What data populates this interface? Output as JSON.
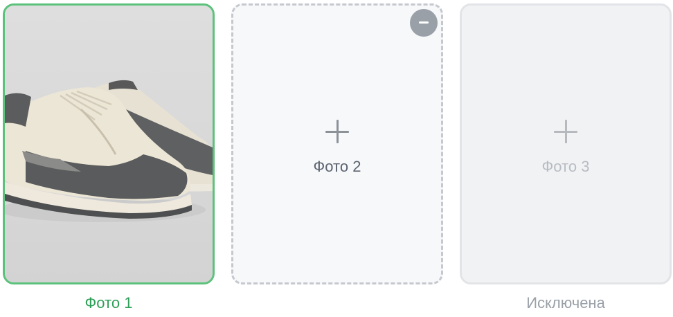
{
  "slots": [
    {
      "caption": "Фото 1",
      "status": "selected"
    },
    {
      "label": "Фото 2",
      "status": "empty"
    },
    {
      "label": "Фото 3",
      "caption": "Исключена",
      "status": "excluded"
    }
  ],
  "icons": {
    "add": "plus-icon",
    "remove": "minus-icon"
  },
  "colors": {
    "selected_border": "#5cc27b",
    "selected_caption": "#2e9f57",
    "remove_button": "#9aa0a8",
    "excluded_caption": "#9aa0a8"
  }
}
